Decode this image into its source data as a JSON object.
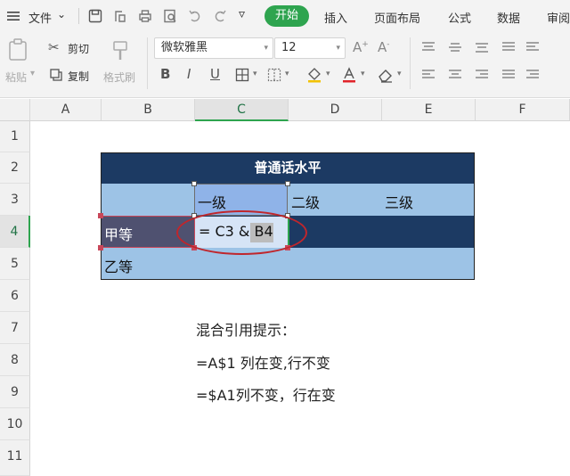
{
  "menu": {
    "file_label": "文件",
    "tabs": [
      "开始",
      "插入",
      "页面布局",
      "公式",
      "数据",
      "审阅"
    ]
  },
  "ribbon": {
    "paste_label": "粘贴",
    "cut_label": "剪切",
    "copy_label": "复制",
    "format_painter_label": "格式刷",
    "font_name": "微软雅黑",
    "font_size": "12",
    "bold": "B",
    "italic": "I",
    "underline": "U"
  },
  "sheet": {
    "columns": [
      "A",
      "B",
      "C",
      "D",
      "E",
      "F"
    ],
    "active_column": "C",
    "rows": [
      "1",
      "2",
      "3",
      "4",
      "5",
      "6",
      "7",
      "8",
      "9",
      "10",
      "11"
    ],
    "active_row": "4"
  },
  "table": {
    "title": "普通话水平",
    "levels": [
      "一级",
      "二级",
      "三级"
    ],
    "grades": [
      "甲等",
      "乙等"
    ],
    "formula": "= C3 & B4"
  },
  "notes": {
    "heading": "混合引用提示：",
    "line1": "=A$1  列在变,行不变",
    "line2": "=$A1列不变，行在变"
  },
  "colors": {
    "accent_green": "#2ea44f",
    "table_dark": "#1c3a63",
    "table_light": "#9dc3e6",
    "highlight_red": "#c0262c"
  }
}
